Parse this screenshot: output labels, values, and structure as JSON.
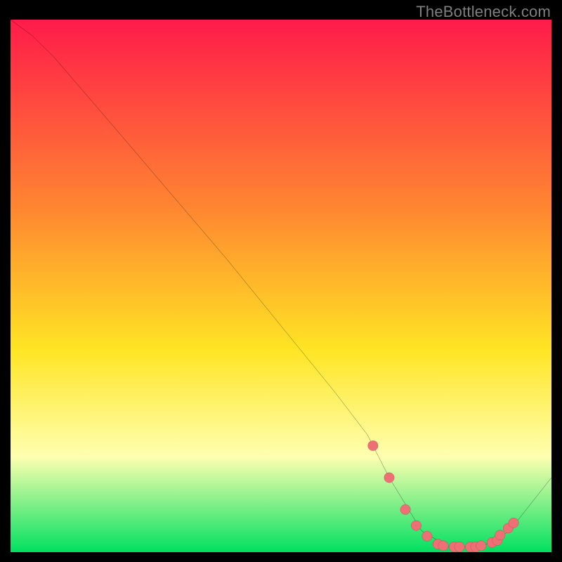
{
  "watermark": "TheBottleneck.com",
  "colors": {
    "bg": "#000000",
    "line": "#000000",
    "dot_fill": "#ef7074",
    "marker_outline": "#000000",
    "grad_top": "#ff1b4a",
    "grad_orange": "#ff8531",
    "grad_yellow": "#ffe524",
    "grad_pale": "#ffffb0",
    "grad_green": "#00e060"
  },
  "chart_data": {
    "type": "line",
    "title": "",
    "xlabel": "",
    "ylabel": "",
    "xlim": [
      0,
      100
    ],
    "ylim": [
      0,
      100
    ],
    "series": [
      {
        "name": "curve",
        "x": [
          0,
          4,
          8,
          19,
          40,
          60,
          66,
          70,
          76,
          81,
          86,
          90,
          93,
          100
        ],
        "y": [
          100,
          97,
          93,
          80,
          55,
          30,
          22,
          14,
          4,
          1,
          1,
          2,
          5,
          14
        ]
      }
    ],
    "markers": {
      "name": "highlight-dots",
      "x": [
        67,
        70,
        73,
        75,
        77,
        79,
        80,
        82,
        83,
        85,
        86,
        87,
        89,
        90,
        90.5,
        92,
        93
      ],
      "y": [
        20,
        14,
        8,
        5,
        3,
        1.5,
        1.2,
        1,
        1,
        1,
        1,
        1.2,
        1.8,
        2.2,
        3.2,
        4.5,
        5.5
      ]
    }
  }
}
